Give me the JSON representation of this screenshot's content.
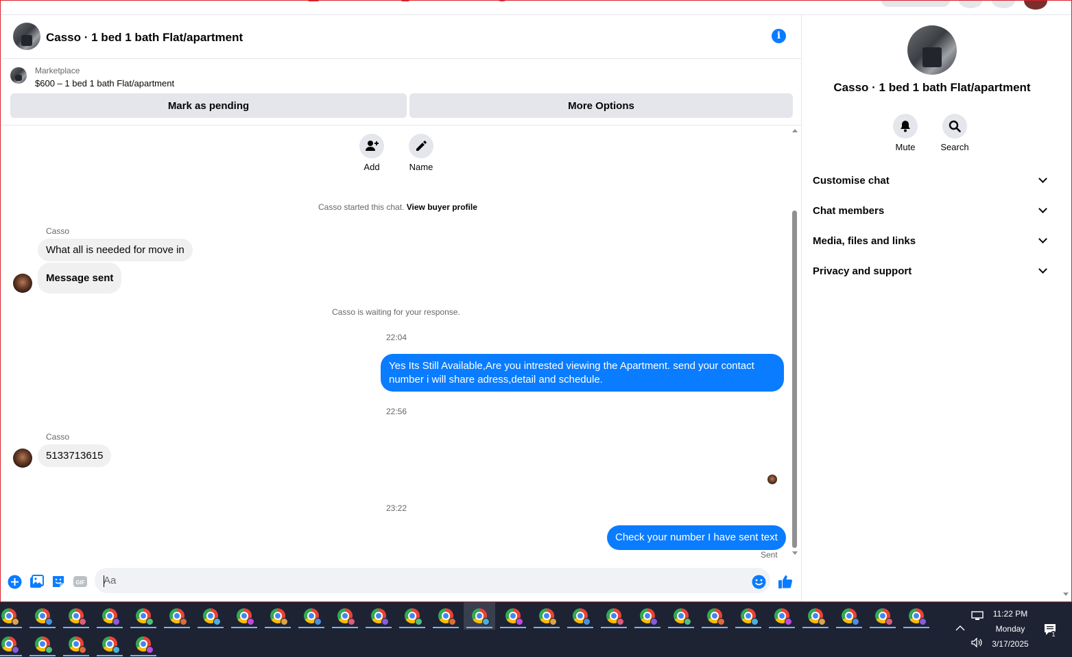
{
  "chat": {
    "title": "Casso · 1 bed 1 bath Flat/apartment",
    "marketplace_label": "Marketplace",
    "listing": "$600 – 1 bed 1 bath Flat/apartment",
    "mark_pending": "Mark as pending",
    "more_options": "More Options",
    "add_label": "Add",
    "name_label": "Name",
    "started_text": "Casso started this chat.",
    "view_profile": "View buyer profile",
    "waiting_text": "Casso is waiting for your response.",
    "messages": [
      {
        "sender": "Casso",
        "text": "What all is needed for move in"
      },
      {
        "text": "Message sent"
      },
      {
        "time": "22:04"
      },
      {
        "text": "Yes Its Still Available,Are you intrested viewing the Apartment. send your contact number i will share adress,detail and schedule."
      },
      {
        "time": "22:56"
      },
      {
        "sender": "Casso",
        "text": "5133713615"
      },
      {
        "time": "23:22"
      },
      {
        "text": "Check your number I have sent text"
      }
    ],
    "sent_status": "Sent",
    "composer_placeholder": "Aa"
  },
  "right_panel": {
    "title": "Casso · 1 bed 1 bath Flat/apartment",
    "mute_label": "Mute",
    "search_label": "Search",
    "sections": [
      "Customise chat",
      "Chat members",
      "Media, files and links",
      "Privacy and support"
    ]
  },
  "taskbar": {
    "time": "11:22 PM",
    "day": "Monday",
    "date": "3/17/2025",
    "notification_count": "1"
  },
  "colors": {
    "accent": "#0a7cff",
    "bubble_in": "#f0f0f0",
    "taskbar": "#1e2334"
  }
}
